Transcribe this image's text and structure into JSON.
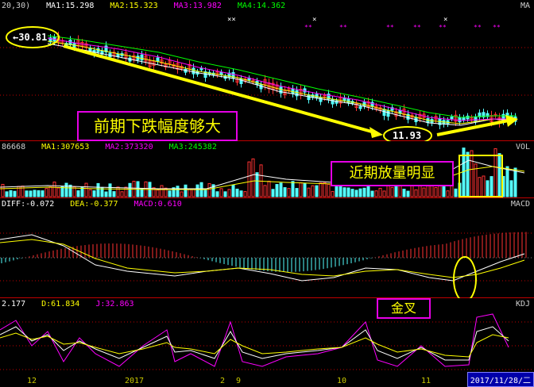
{
  "price_panel": {
    "legend": [
      {
        "text": "20,30)",
        "color": "#cfcfcf"
      },
      {
        "text": "MA1:15.298",
        "color": "#ffffff"
      },
      {
        "text": "MA2:15.323",
        "color": "#ffff00"
      },
      {
        "text": "MA3:13.982",
        "color": "#ff00ff"
      },
      {
        "text": "MA4:14.362",
        "color": "#00ff00"
      }
    ],
    "tag": "MA",
    "high_label": "30.81",
    "low_label": "11.93",
    "high_marker": "←",
    "star_mark": "**",
    "callout": "前期下跌幅度够大"
  },
  "volume_panel": {
    "legend": [
      {
        "text": "86668",
        "color": "#cfcfcf"
      },
      {
        "text": "MA1:307653",
        "color": "#ffff00"
      },
      {
        "text": "MA2:373320",
        "color": "#ff00ff"
      },
      {
        "text": "MA3:245382",
        "color": "#00ff00"
      }
    ],
    "tag": "VOL",
    "callout": "近期放量明显"
  },
  "macd_panel": {
    "legend": [
      {
        "text": "DIFF:-0.072",
        "color": "#ffffff"
      },
      {
        "text": "DEA:-0.377",
        "color": "#ffff00"
      },
      {
        "text": "MACD:0.610",
        "color": "#ff00ff"
      }
    ],
    "tag": "MACD"
  },
  "kdj_panel": {
    "legend": [
      {
        "text": "2.177",
        "color": "#ffffff"
      },
      {
        "text": "D:61.834",
        "color": "#ffff00"
      },
      {
        "text": "J:32.863",
        "color": "#ff00ff"
      }
    ],
    "tag": "KDJ",
    "callout": "金叉"
  },
  "x_axis": {
    "labels": [
      "12",
      "2017",
      "2",
      "9",
      "10",
      "11"
    ],
    "current_date": "2017/11/28/二"
  },
  "colors": {
    "up": "#ff3232",
    "down": "#54ffff",
    "annotation": "#ffff00",
    "callout_border": "#e600e6",
    "grid": "#c00000"
  }
}
